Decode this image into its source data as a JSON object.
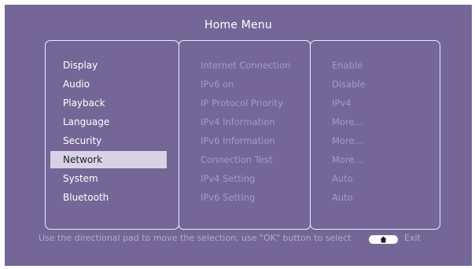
{
  "screen": {
    "title": "Home Menu"
  },
  "menu": {
    "items": [
      {
        "label": "Display"
      },
      {
        "label": "Audio"
      },
      {
        "label": "Playback"
      },
      {
        "label": "Language"
      },
      {
        "label": "Security"
      },
      {
        "label": "Network"
      },
      {
        "label": "System"
      },
      {
        "label": "Bluetooth"
      }
    ],
    "selected": "Network"
  },
  "settings": {
    "items": [
      {
        "label": "Internet Connection",
        "value": "Enable"
      },
      {
        "label": "IPv6 on",
        "value": "Disable"
      },
      {
        "label": "IP Protocol Priority",
        "value": "IPv4"
      },
      {
        "label": "IPv4 Information",
        "value": "More..."
      },
      {
        "label": "IPv6 Information",
        "value": "More..."
      },
      {
        "label": "Connection Test",
        "value": "More..."
      },
      {
        "label": "IPv4 Setting",
        "value": "Auto"
      },
      {
        "label": "IPv6 Setting",
        "value": "Auto"
      }
    ]
  },
  "footer": {
    "hint": "Use the directional pad to move the selection, use \"OK\" button to select",
    "exit_label": "Exit",
    "home_icon": "home-icon"
  },
  "colors": {
    "background": "#746797",
    "selection": "#d8d3e4",
    "disabled_text": "#a59bc0"
  }
}
